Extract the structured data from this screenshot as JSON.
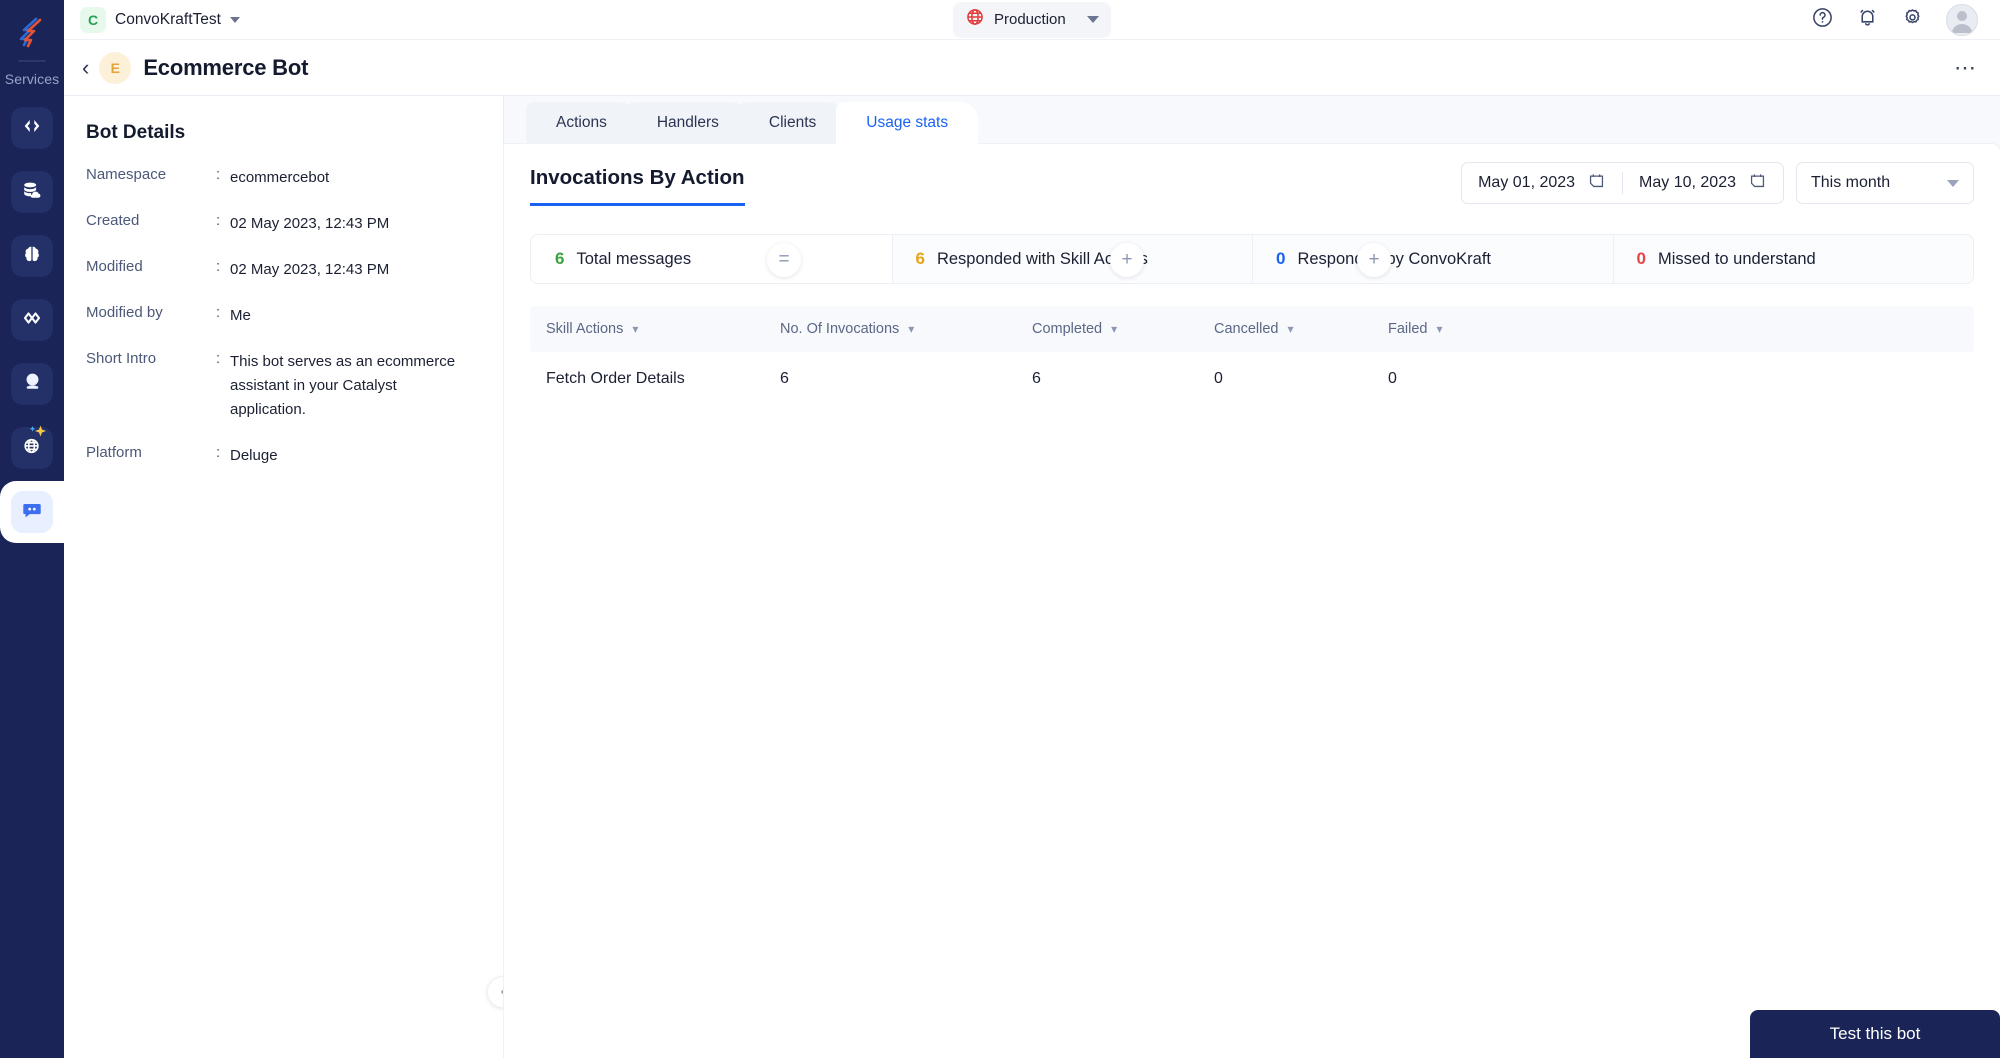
{
  "rail": {
    "logo_icon": "catalyst-logo-icon",
    "services_label": "Services",
    "items": [
      {
        "icon": "code-brackets-icon",
        "name": "functions"
      },
      {
        "icon": "database-cloud-icon",
        "name": "data-store"
      },
      {
        "icon": "brain-icon",
        "name": "ai-services"
      },
      {
        "icon": "infinity-link-icon",
        "name": "integrations"
      },
      {
        "icon": "crystal-ball-icon",
        "name": "smart-browz"
      },
      {
        "icon": "globe-sparkle-icon",
        "name": "quickml"
      },
      {
        "icon": "chat-bubble-icon",
        "name": "convokraft"
      }
    ]
  },
  "topbar": {
    "org_initial": "C",
    "org_name": "ConvoKraftTest",
    "org_caret_icon": "chevron-down-icon",
    "environment": {
      "icon": "globe-icon",
      "label": "Production",
      "caret_icon": "chevron-down-icon"
    },
    "actions": [
      {
        "icon": "help-circle-icon",
        "name": "help"
      },
      {
        "icon": "bell-icon",
        "name": "notifications"
      },
      {
        "icon": "gear-icon",
        "name": "settings"
      },
      {
        "icon": "avatar-icon",
        "name": "user-profile"
      }
    ]
  },
  "bot_header": {
    "back_icon": "chevron-left-icon",
    "badge_initial": "E",
    "title": "Ecommerce Bot",
    "more_icon": "ellipsis-horizontal-icon"
  },
  "details": {
    "heading": "Bot Details",
    "separator": ":",
    "rows": [
      {
        "key": "Namespace",
        "value": "ecommercebot"
      },
      {
        "key": "Created",
        "value": "02 May 2023, 12:43 PM"
      },
      {
        "key": "Modified",
        "value": "02 May 2023, 12:43 PM"
      },
      {
        "key": "Modified by",
        "value": "Me"
      },
      {
        "key": "Short Intro",
        "value": "This bot serves as an ecommerce assistant in your Catalyst application."
      },
      {
        "key": "Platform",
        "value": "Deluge"
      }
    ],
    "collapse_icon": "chevron-left-icon"
  },
  "tabs": [
    {
      "label": "Actions",
      "active": false
    },
    {
      "label": "Handlers",
      "active": false
    },
    {
      "label": "Clients",
      "active": false
    },
    {
      "label": "Usage stats",
      "active": true
    }
  ],
  "panel": {
    "title": "Invocations By Action",
    "date_from": "May 01, 2023",
    "date_to": "May 10, 2023",
    "date_icon": "calendar-icon",
    "range_preset": "This month",
    "range_caret_icon": "chevron-down-icon"
  },
  "summary": {
    "cells": [
      {
        "value": "6",
        "label": "Total messages",
        "color": "#3aa33f",
        "op_after": "="
      },
      {
        "value": "6",
        "label": "Responded with Skill Actions",
        "color": "#e8a317",
        "op_after": "+"
      },
      {
        "value": "0",
        "label": "Responded by ConvoKraft",
        "color": "#1a62f2",
        "op_after": "+"
      },
      {
        "value": "0",
        "label": "Missed to understand",
        "color": "#e64545",
        "op_after": ""
      }
    ]
  },
  "table": {
    "columns": [
      {
        "label": "Skill Actions",
        "sort_icon": "chevron-down-icon"
      },
      {
        "label": "No. Of Invocations",
        "sort_icon": "chevron-down-icon"
      },
      {
        "label": "Completed",
        "sort_icon": "chevron-down-icon"
      },
      {
        "label": "Cancelled",
        "sort_icon": "chevron-down-icon"
      },
      {
        "label": "Failed",
        "sort_icon": "chevron-down-icon"
      }
    ],
    "rows": [
      {
        "skill_action": "Fetch Order Details",
        "invocations": "6",
        "completed": "6",
        "cancelled": "0",
        "failed": "0"
      }
    ]
  },
  "footer": {
    "test_bot_label": "Test this bot"
  },
  "colors": {
    "rail_bg": "#1b2457",
    "accent_blue": "#1a62f2",
    "green": "#3aa33f",
    "amber": "#e8a317",
    "red": "#e64545",
    "panel_bg": "#f7f9fc"
  }
}
